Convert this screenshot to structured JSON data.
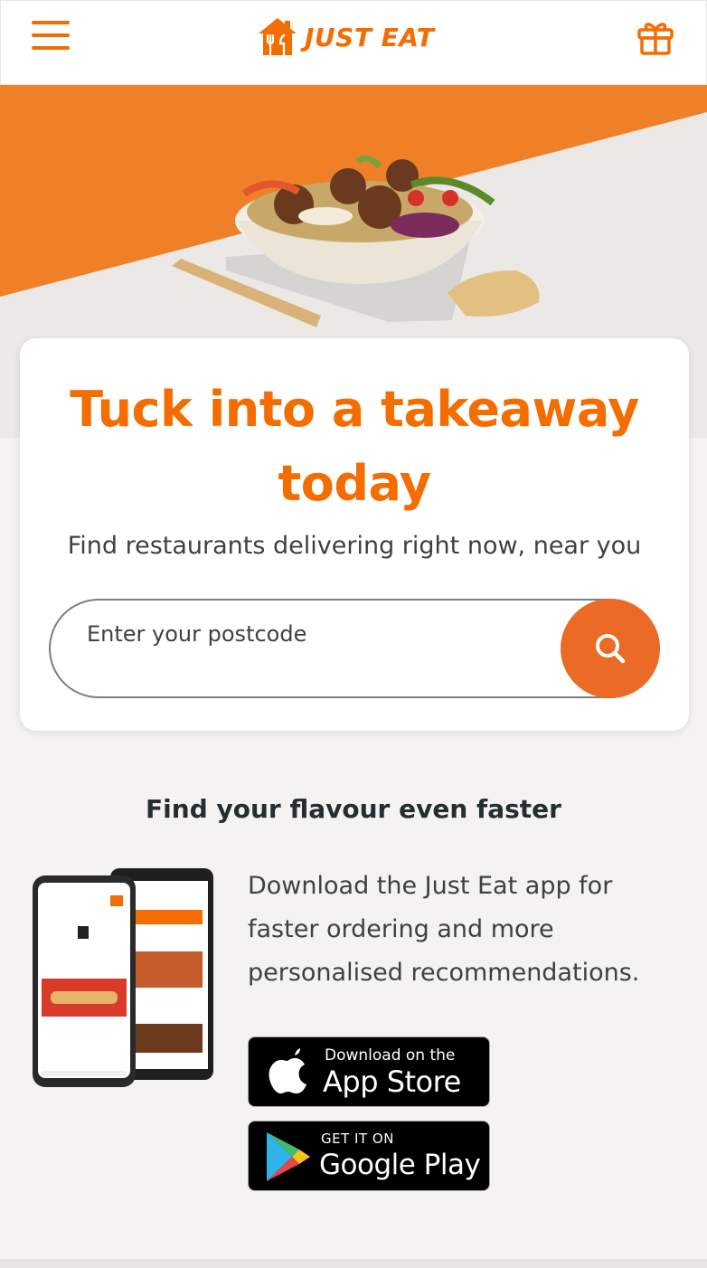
{
  "header": {
    "logo_text": "JUST EAT",
    "menu_icon": "hamburger-menu-icon",
    "gift_icon": "gift-icon"
  },
  "hero": {
    "title": "Tuck into a takeaway today",
    "subtitle": "Find restaurants delivering right now, near you",
    "search": {
      "placeholder": "Enter your postcode",
      "value": "",
      "button_icon": "search-icon"
    }
  },
  "app_section": {
    "heading": "Find your flavour even faster",
    "description": "Download the Just Eat app for faster ordering and more personalised recommendations.",
    "app_store": {
      "small": "Download on the",
      "big": "App Store"
    },
    "google_play": {
      "small": "GET IT ON",
      "big": "Google Play"
    }
  },
  "colors": {
    "brand_orange": "#f36d00",
    "search_button": "#ea6a26",
    "text_dark": "#242e30"
  }
}
